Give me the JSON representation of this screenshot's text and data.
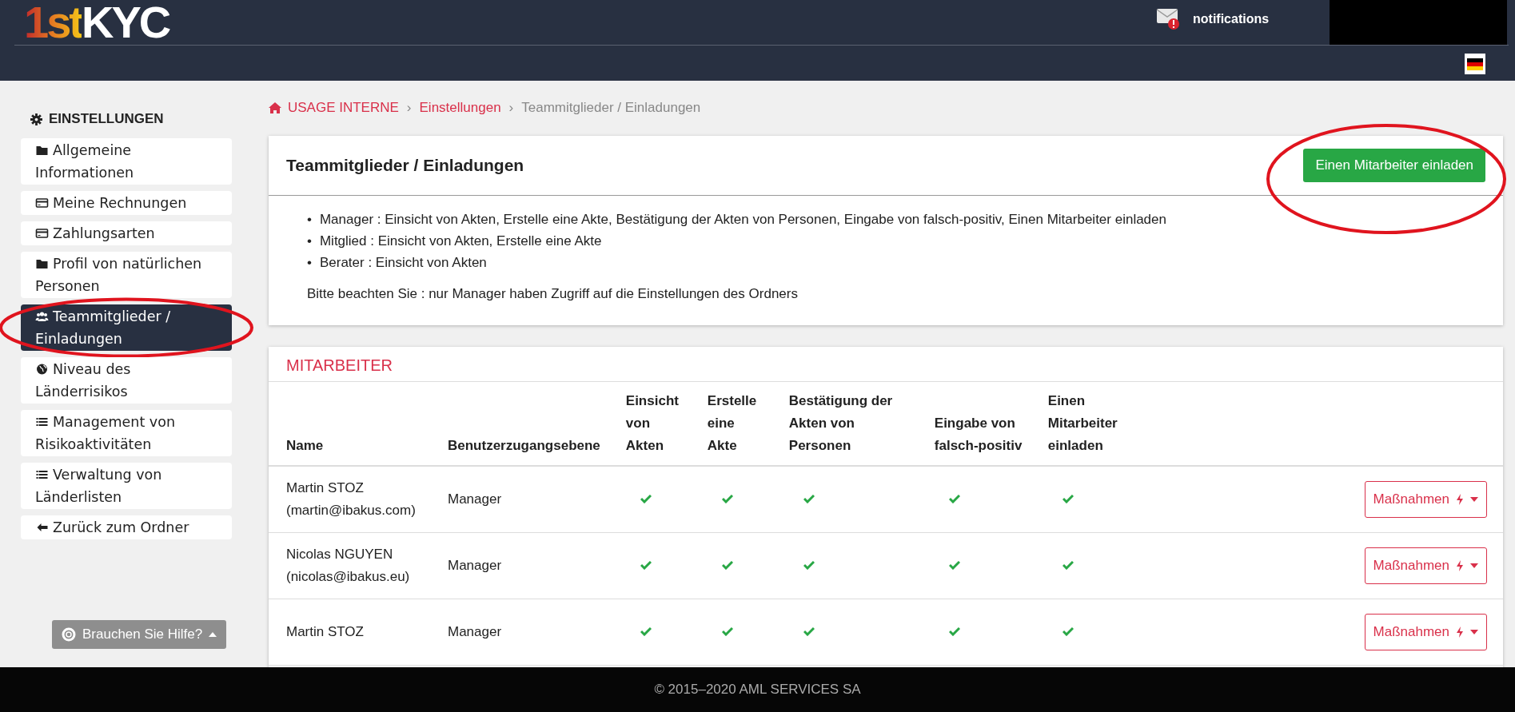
{
  "header": {
    "logo": {
      "part1": "1st",
      "part2": "KYC"
    },
    "notifications": "notifications"
  },
  "sidebar": {
    "title": "EINSTELLUNGEN",
    "items": [
      {
        "label": "Allgemeine Informationen",
        "selected": false
      },
      {
        "label": "Meine Rechnungen",
        "selected": false
      },
      {
        "label": "Zahlungsarten",
        "selected": false
      },
      {
        "label": "Profil von natürlichen Personen",
        "selected": false
      },
      {
        "label": "Teammitglieder / Einladungen",
        "selected": true
      },
      {
        "label": "Niveau des Länderrisikos",
        "selected": false
      },
      {
        "label": "Management von Risikoaktivitäten",
        "selected": false
      },
      {
        "label": "Verwaltung von Länderlisten",
        "selected": false
      },
      {
        "label": "Zurück zum Ordner",
        "selected": false
      }
    ],
    "help": "Brauchen Sie Hilfe?"
  },
  "breadcrumb": {
    "separator": "›",
    "items": [
      {
        "label": "USAGE INTERNE",
        "selected": false
      },
      {
        "label": "Einstellungen",
        "selected": false
      },
      {
        "label": "Teammitglieder / Einladungen",
        "selected": true
      }
    ]
  },
  "info_card": {
    "title": "Teammitglieder / Einladungen",
    "button": "Einen Mitarbeiter einladen",
    "bullet": "•",
    "roles": [
      "Manager : Einsicht von Akten, Erstelle eine Akte, Bestätigung der Akten von Personen, Eingabe von falsch-positiv, Einen Mitarbeiter einladen",
      "Mitglied : Einsicht von Akten, Erstelle eine Akte",
      "Berater : Einsicht von Akten"
    ],
    "note": "Bitte beachten Sie : nur Manager haben Zugriff auf die Einstellungen des Ordners"
  },
  "staff": {
    "title": "MITARBEITER",
    "columns": [
      "Name",
      "Benutzerzugangsebene",
      "Einsicht von Akten",
      "Erstelle eine Akte",
      "Bestätigung der Akten von Personen",
      "Eingabe von falsch-positiv",
      "Einen Mitarbeiter einladen"
    ],
    "rows": [
      {
        "name": "Martin STOZ",
        "email": "(martin@ibakus.com)",
        "level": "Manager",
        "permissions": [
          true,
          true,
          true,
          true,
          true
        ],
        "action": "Maßnahmen"
      },
      {
        "name": "Nicolas NGUYEN",
        "email": "(nicolas@ibakus.eu)",
        "level": "Manager",
        "permissions": [
          true,
          true,
          true,
          true,
          true
        ],
        "action": "Maßnahmen"
      },
      {
        "name": "Martin STOZ",
        "level": "Manager",
        "permissions": [
          true,
          true,
          true,
          true,
          true
        ],
        "action": "Maßnahmen"
      }
    ]
  },
  "footer": "© 2015–2020 AML SERVICES SA"
}
